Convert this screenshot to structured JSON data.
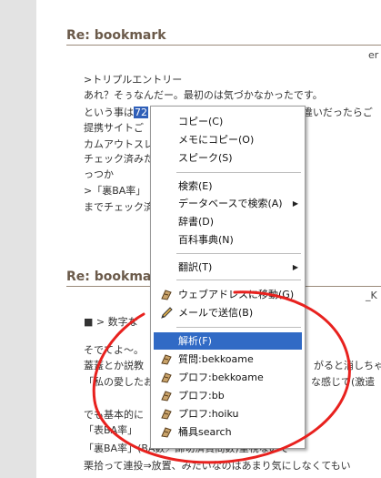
{
  "posts": [
    {
      "title": "Re: bookmark",
      "author_fragment": "er",
      "lines": [
        ">トリプルエントリー",
        "あれ？そぅなんだー。最初のは気づかなかったです。",
        "という事は",
        "提携サイトご",
        "カムアウトスレ",
        "チェック済みた",
        "っつか",
        ">「裏BA率」",
        "までチェック済"
      ],
      "selected_text": "72",
      "line2_tail": "でー、エントリーの数違いだったらご"
    },
    {
      "title": "Re: bookma",
      "author_fragment": "_K",
      "lines": [
        "■ > 数字な",
        "そでてよ〜。",
        "蓋蓋とか説教",
        "「私の愛したお",
        "でも基本的に",
        "「表BA率」",
        "「裏BA率」(BA数／締切済質問数)重視なので",
        "栗拾って連投⇒放置、みたいなのはあまり気にしなくてもい"
      ],
      "right_fragments": {
        "line2": "がると消しちゃ",
        "line3": "な感じで(激遣"
      }
    }
  ],
  "context_menu": {
    "items": [
      {
        "label": "コピー(C)",
        "icon": null
      },
      {
        "label": "メモにコピー(O)",
        "icon": null
      },
      {
        "label": "スピーク(S)",
        "icon": null
      },
      {
        "label": "検索(E)",
        "icon": null
      },
      {
        "label": "データベースで検索(A)",
        "icon": null,
        "submenu": true
      },
      {
        "label": "辞書(D)",
        "icon": null
      },
      {
        "label": "百科事典(N)",
        "icon": null
      },
      {
        "label": "翻訳(T)",
        "icon": null,
        "submenu": true
      },
      {
        "label": "ウェブアドレスに移動(G)",
        "icon": "hatena-icon"
      },
      {
        "label": "メールで送信(B)",
        "icon": "pencil-icon"
      },
      {
        "label": "解析(F)",
        "icon": null,
        "selected": true
      },
      {
        "label": "質問:bekkoame",
        "icon": "hatena-icon"
      },
      {
        "label": "プロフ:bekkoame",
        "icon": "hatena-icon"
      },
      {
        "label": "プロフ:bb",
        "icon": "hatena-icon"
      },
      {
        "label": "プロフ:hoiku",
        "icon": "hatena-icon"
      },
      {
        "label": "桶具search",
        "icon": "hatena-icon"
      }
    ]
  },
  "annotation": {
    "color": "#e8211e"
  }
}
